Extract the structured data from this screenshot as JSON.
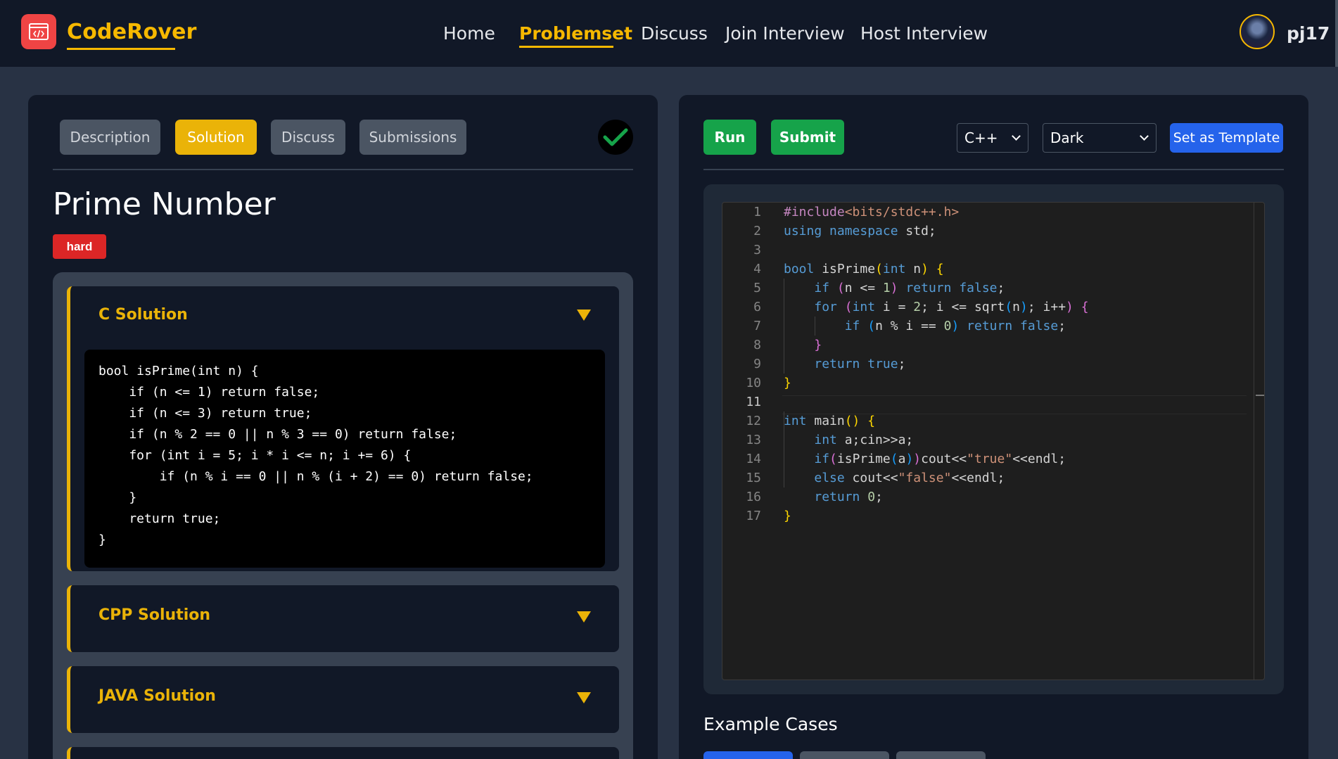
{
  "brand": {
    "name": "CodeRover"
  },
  "nav": {
    "links": [
      {
        "label": "Home"
      },
      {
        "label": "Problemset"
      },
      {
        "label": "Discuss"
      },
      {
        "label": "Join Interview"
      },
      {
        "label": "Host Interview"
      }
    ],
    "active": "Problemset",
    "username": "pj17"
  },
  "problem": {
    "tabs": [
      {
        "label": "Description"
      },
      {
        "label": "Solution"
      },
      {
        "label": "Discuss"
      },
      {
        "label": "Submissions"
      }
    ],
    "active_tab": "Solution",
    "solved_icon": "check-icon",
    "title": "Prime Number",
    "difficulty": "hard",
    "solutions": [
      {
        "title": "C Solution",
        "expanded": true,
        "code": [
          "bool isPrime(int n) {",
          "    if (n <= 1) return false;",
          "    if (n <= 3) return true;",
          "    if (n % 2 == 0 || n % 3 == 0) return false;",
          "    for (int i = 5; i * i <= n; i += 6) {",
          "        if (n % i == 0 || n % (i + 2) == 0) return false;",
          "    }",
          "    return true;",
          "}"
        ]
      },
      {
        "title": "CPP Solution",
        "expanded": false
      },
      {
        "title": "JAVA Solution",
        "expanded": false
      }
    ]
  },
  "editor_toolbar": {
    "run_label": "Run",
    "submit_label": "Submit",
    "language": "C++",
    "theme": "Dark",
    "template_label": "Set as Template"
  },
  "editor": {
    "line_numbers": [
      "1",
      "2",
      "3",
      "4",
      "5",
      "6",
      "7",
      "8",
      "9",
      "10",
      "11",
      "12",
      "13",
      "14",
      "15",
      "16",
      "17"
    ],
    "current_line": 11,
    "code": [
      "#include<bits/stdc++.h>",
      "using namespace std;",
      "",
      "bool isPrime(int n) {",
      "    if (n <= 1) return false;",
      "    for (int i = 2; i <= sqrt(n); i++) {",
      "        if (n % i == 0) return false;",
      "    }",
      "    return true;",
      "}",
      "",
      "int main() {",
      "    int a;cin>>a;",
      "    if(isPrime(a))cout<<\"true\"<<endl;",
      "    else cout<<\"false\"<<endl;",
      "    return 0;",
      "}"
    ]
  },
  "examples": {
    "title": "Example Cases"
  },
  "colors": {
    "accent": "#f6b800",
    "navbar_bg": "#111827",
    "page_bg": "#283244",
    "run_green": "#16a34a",
    "template_blue": "#2563eb",
    "difficulty_red": "#dc2626"
  }
}
